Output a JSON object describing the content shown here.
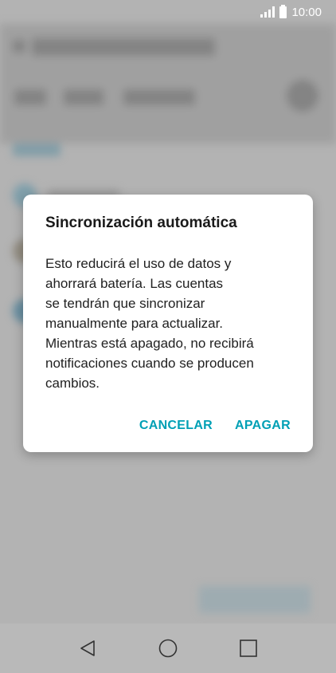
{
  "status_bar": {
    "time": "10:00",
    "icons": [
      "signal-icon",
      "battery-icon"
    ]
  },
  "dialog": {
    "title": "Sincronización automática",
    "message": "Esto reducirá el uso de datos y\nahorrará batería. Las cuentas\nse tendrán que sincronizar\nmanualmente para actualizar.\nMientras está apagado, no recibirá\nnotificaciones cuando se producen\ncambios.",
    "cancel_label": "CANCELAR",
    "confirm_label": "APAGAR"
  },
  "nav_bar": {
    "icons": [
      "back-icon",
      "home-icon",
      "recents-icon"
    ]
  },
  "colors": {
    "accent": "#00a0b5",
    "nav_icon": "#333333",
    "dialog_background": "#ffffff"
  }
}
